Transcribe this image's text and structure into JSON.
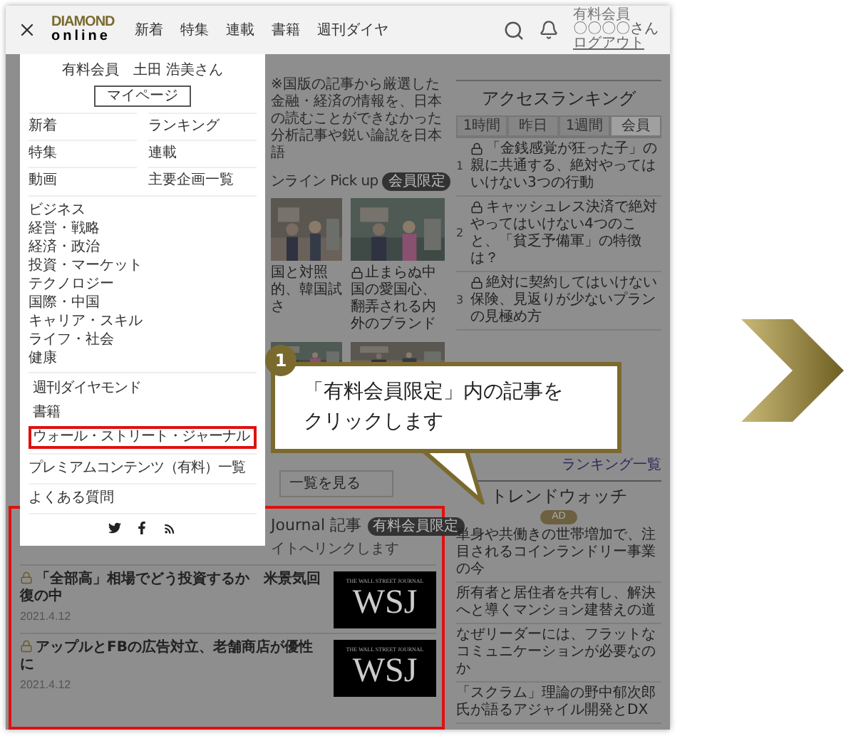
{
  "header": {
    "logo_top": "DIAMOND",
    "logo_bottom": "online",
    "nav": [
      "新着",
      "特集",
      "連載",
      "書籍",
      "週刊ダイヤ"
    ],
    "member_label": "有料会員",
    "member_name": "〇〇〇〇さん",
    "logout": "ログアウト"
  },
  "menu": {
    "greeting": "有料会員　土田 浩美さん",
    "mypage_button": "マイページ",
    "grid": [
      "新着",
      "ランキング",
      "特集",
      "連載",
      "動画",
      "主要企画一覧"
    ],
    "categories": [
      "ビジネス",
      "経営・戦略",
      "経済・政治",
      "投資・マーケット",
      "テクノロジー",
      "国際・中国",
      "キャリア・スキル",
      "ライフ・社会",
      "健康"
    ],
    "publications": [
      {
        "label": "週刊ダイヤモンド",
        "highlighted": false
      },
      {
        "label": "書籍",
        "highlighted": false
      },
      {
        "label": "ウォール・ストリート・ジャーナル",
        "highlighted": true
      }
    ],
    "premium": "プレミアムコンテンツ（有料）一覧",
    "faq": "よくある質問"
  },
  "main": {
    "intro": "※国版の記事から厳選した金融・経済の情報を、日本の読むことができなかった分析記事や鋭い論説を日本語",
    "pickup_title": "ンライン Pick up",
    "pickup_badge": "会員限定",
    "pickup_items": [
      {
        "caption": "国と対照的、韓国試さ",
        "locked": false
      },
      {
        "caption": "止まらぬ中国の愛国心、翻弄される内外のブランド",
        "locked": true
      }
    ],
    "more_button": "一覧を見る"
  },
  "wsj_section": {
    "highlighted": true,
    "title": "Journal 記事",
    "badge": "有料会員限定",
    "subtitle": "イトへリンクします",
    "articles": [
      {
        "title": "「全部高」相場でどう投資するか　米景気回復の中",
        "date": "2021.4.12",
        "logo_small": "THE WALL STREET JOURNAL",
        "logo": "WSJ"
      },
      {
        "title": "アップルとFBの広告対立、老舗商店が優性に",
        "date": "2021.4.12",
        "logo_small": "THE WALL STREET JOURNAL",
        "logo": "WSJ"
      }
    ]
  },
  "ranking": {
    "title": "アクセスランキング",
    "tabs": [
      {
        "label": "1時間",
        "selected": false
      },
      {
        "label": "昨日",
        "selected": false
      },
      {
        "label": "1週間",
        "selected": false
      },
      {
        "label": "会員",
        "selected": true
      }
    ],
    "items": [
      {
        "rank": "1",
        "title": "「金銭感覚が狂った子」の親に共通する、絶対やってはいけない3つの行動"
      },
      {
        "rank": "2",
        "title": "キャッシュレス決済で絶対やってはいけない4つのこと、「貧乏予備軍」の特徴は？"
      },
      {
        "rank": "3",
        "title": "絶対に契約してはいけない保険、見返りが少ないプランの見極め方"
      }
    ],
    "more_link": "ランキング一覧"
  },
  "trend": {
    "title": "トレンドウォッチ",
    "badge": "AD",
    "items": [
      "単身や共働きの世帯増加で、注目されるコインランドリー事業の今",
      "所有者と居住者を共有し、解決へと導くマンション建替えの道",
      "なぜリーダーには、フラットなコミュニケーションが必要なのか",
      "「スクラム」理論の野中郁次郎氏が語るアジャイル開発とDX"
    ]
  },
  "callout": {
    "step": "1",
    "text": "「有料会員限定」内の記事をクリックします"
  }
}
